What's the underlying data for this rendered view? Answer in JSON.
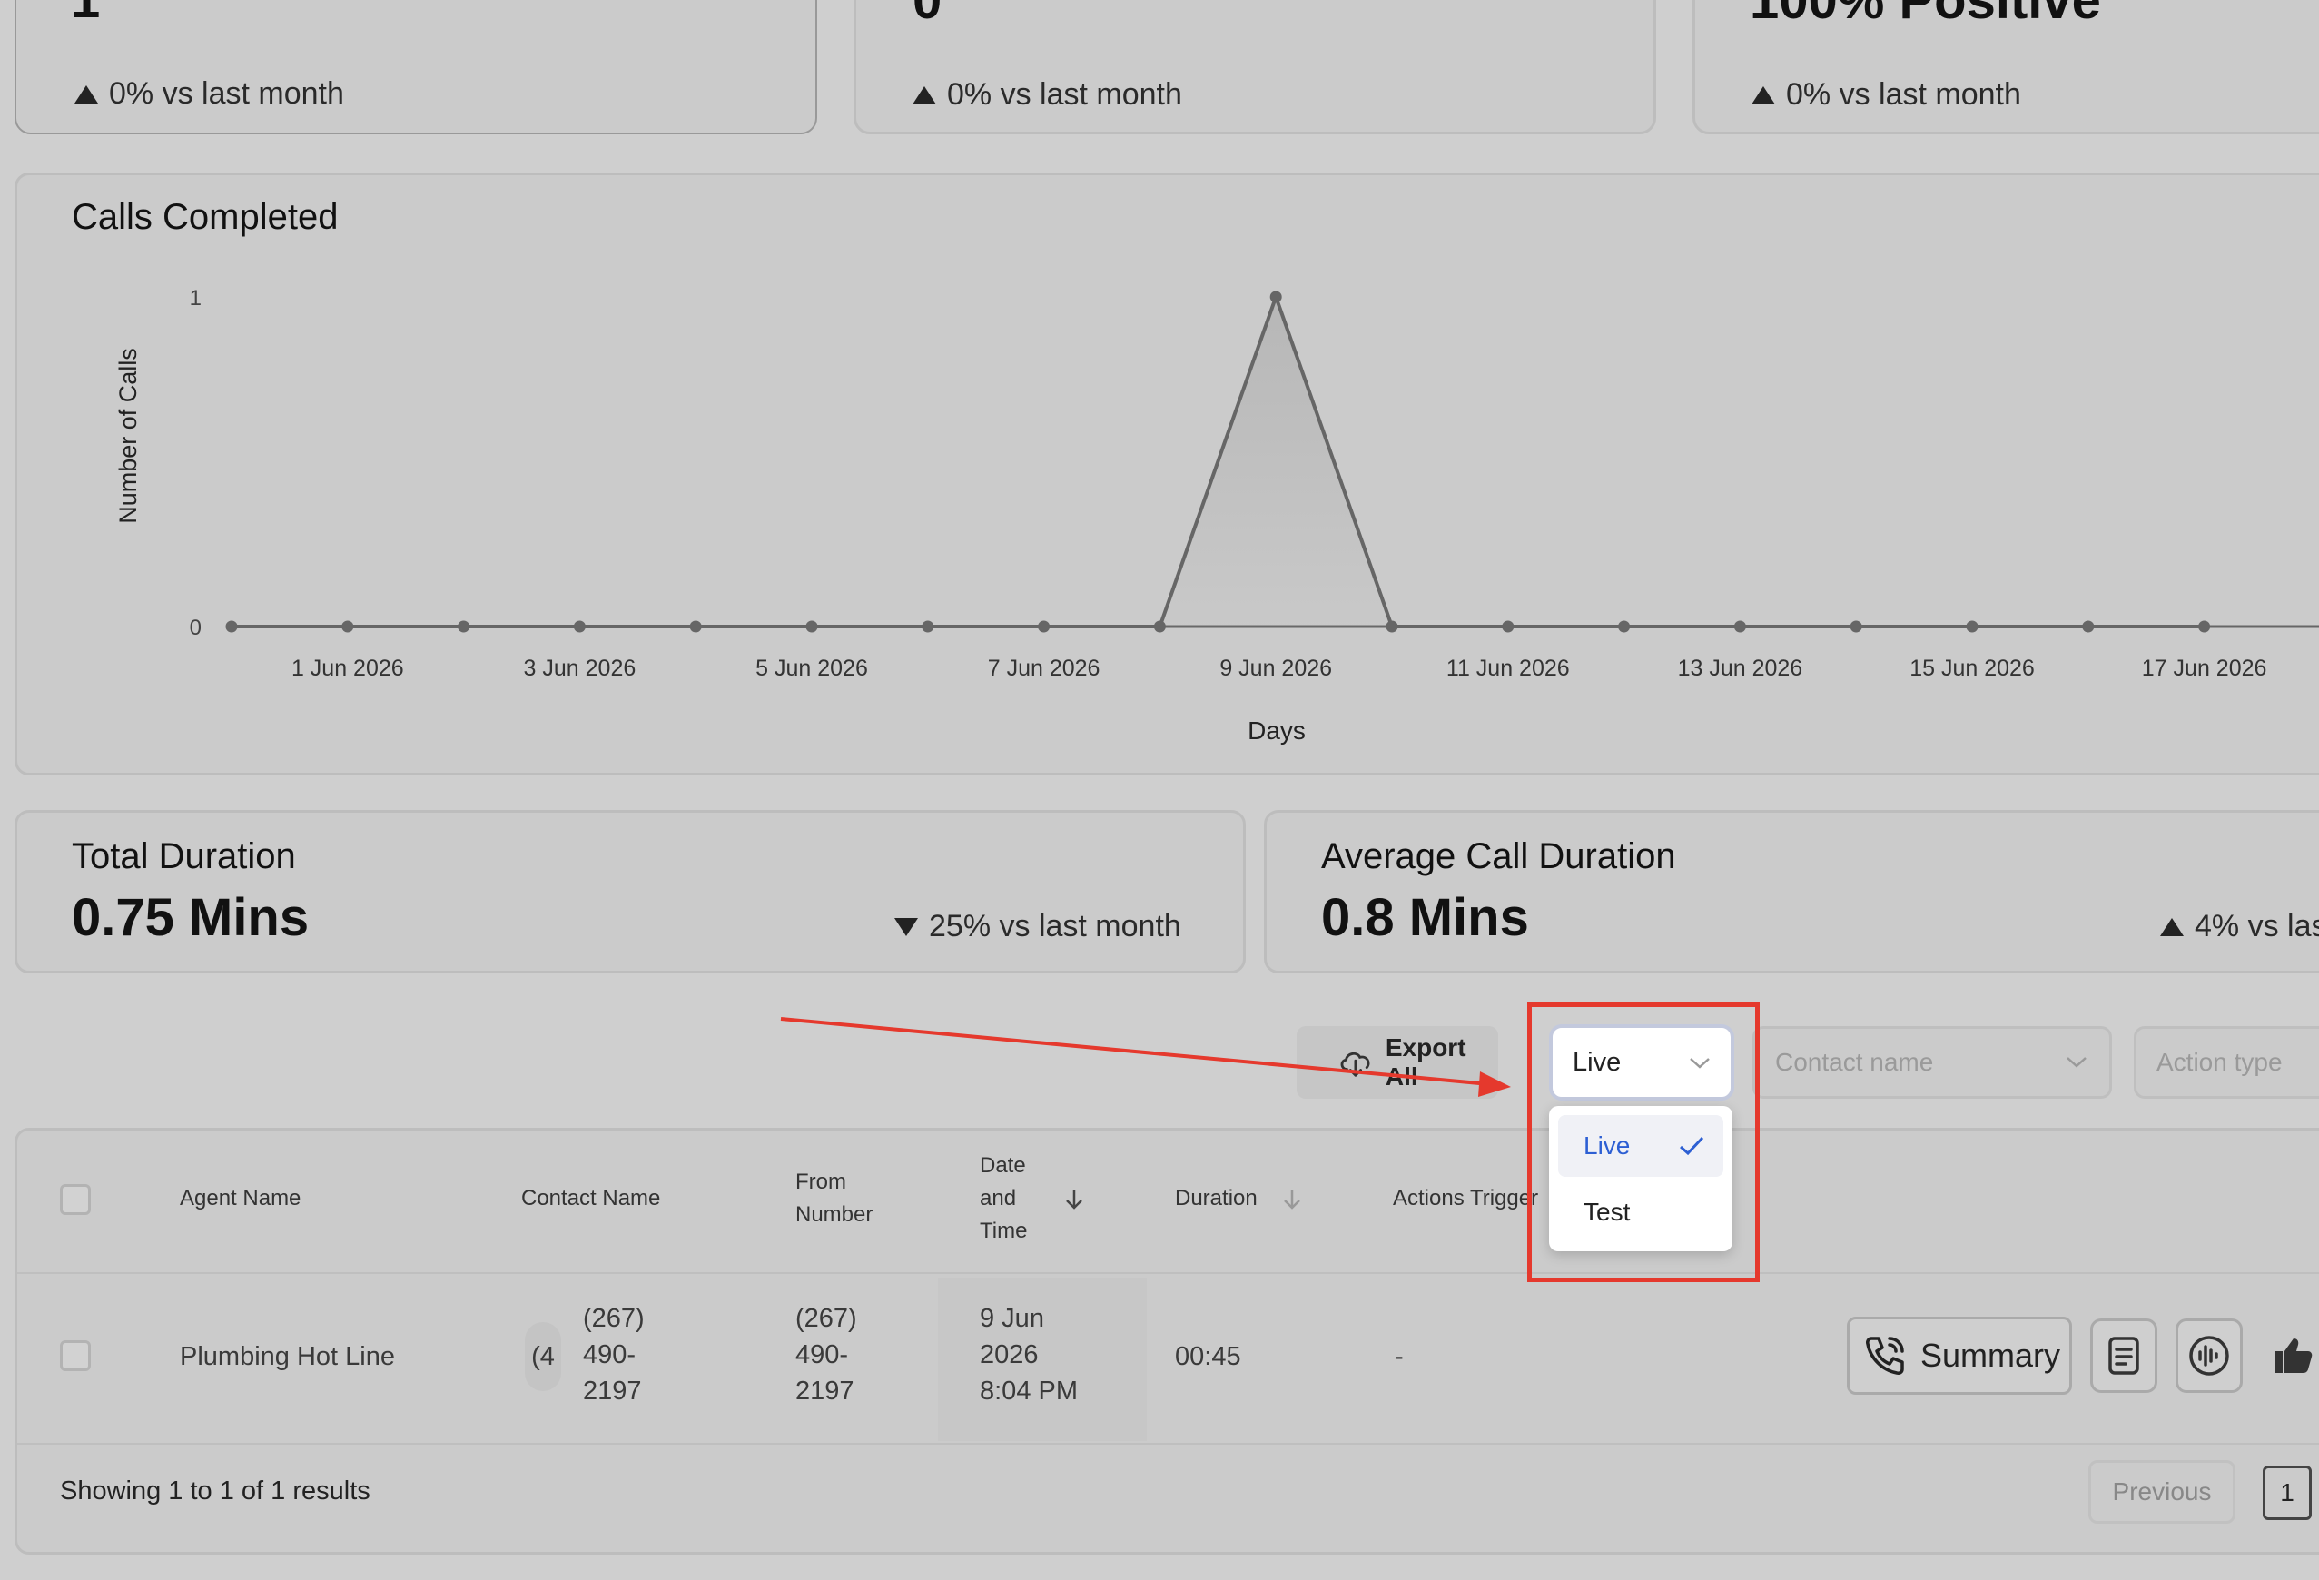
{
  "stats_top": [
    {
      "value": "1",
      "trend": "0% vs last month"
    },
    {
      "value": "0",
      "trend": "0% vs last month"
    },
    {
      "value": "100% Positive",
      "trend": "0% vs last month"
    }
  ],
  "chart_card": {
    "title": "Calls Completed"
  },
  "chart_data": {
    "type": "line",
    "title": "Calls Completed",
    "xlabel": "Days",
    "ylabel": "Number of Calls",
    "ylim": [
      0,
      1
    ],
    "yticks": [
      "0",
      "1"
    ],
    "x": [
      "31 May 2026",
      "1 Jun 2026",
      "2 Jun 2026",
      "3 Jun 2026",
      "4 Jun 2026",
      "5 Jun 2026",
      "6 Jun 2026",
      "7 Jun 2026",
      "8 Jun 2026",
      "9 Jun 2026",
      "10 Jun 2026",
      "11 Jun 2026",
      "12 Jun 2026",
      "13 Jun 2026",
      "14 Jun 2026",
      "15 Jun 2026",
      "16 Jun 2026",
      "17 Jun 2026"
    ],
    "xtick_labels": [
      "1 Jun 2026",
      "3 Jun 2026",
      "5 Jun 2026",
      "7 Jun 2026",
      "9 Jun 2026",
      "11 Jun 2026",
      "13 Jun 2026",
      "15 Jun 2026",
      "17 Jun 2026"
    ],
    "series": [
      {
        "values": [
          0,
          0,
          0,
          0,
          0,
          0,
          0,
          0,
          0,
          1,
          0,
          0,
          0,
          0,
          0,
          0,
          0,
          0
        ]
      }
    ],
    "grid": false,
    "legend": "none"
  },
  "duration_cards": [
    {
      "title": "Total Duration",
      "value": "0.75 Mins",
      "trend": "25% vs last month",
      "direction": "down"
    },
    {
      "title": "Average Call Duration",
      "value": "0.8 Mins",
      "trend": "4% vs las",
      "direction": "up"
    }
  ],
  "toolbar": {
    "export_label": "Export All",
    "environment_select": {
      "value": "Live",
      "options": [
        "Live",
        "Test"
      ],
      "selected": "Live"
    },
    "contact_placeholder": "Contact name",
    "action_placeholder": "Action type"
  },
  "table": {
    "headers": {
      "agent": "Agent Name",
      "contact": "Contact Name",
      "from": [
        "From",
        "Number"
      ],
      "date": [
        "Date",
        "and",
        "Time"
      ],
      "duration": "Duration",
      "actions": "Actions Trigger"
    },
    "rows": [
      {
        "agent": "Plumbing Hot Line",
        "contact_avatar": "(4",
        "contact": [
          "(267)",
          "490-",
          "2197"
        ],
        "from": [
          "(267)",
          "490-",
          "2197"
        ],
        "date": [
          "9 Jun",
          "2026",
          "8:04 PM"
        ],
        "duration": "00:45",
        "actions": "-",
        "summary_label": "Summary"
      }
    ],
    "footer": "Showing 1 to 1 of 1 results",
    "pagination": {
      "previous": "Previous",
      "page": "1"
    }
  },
  "colors": {
    "highlight": "#e5392d",
    "accent_blue": "#2d5fd3",
    "dropdown_bg": "#ffffff"
  }
}
